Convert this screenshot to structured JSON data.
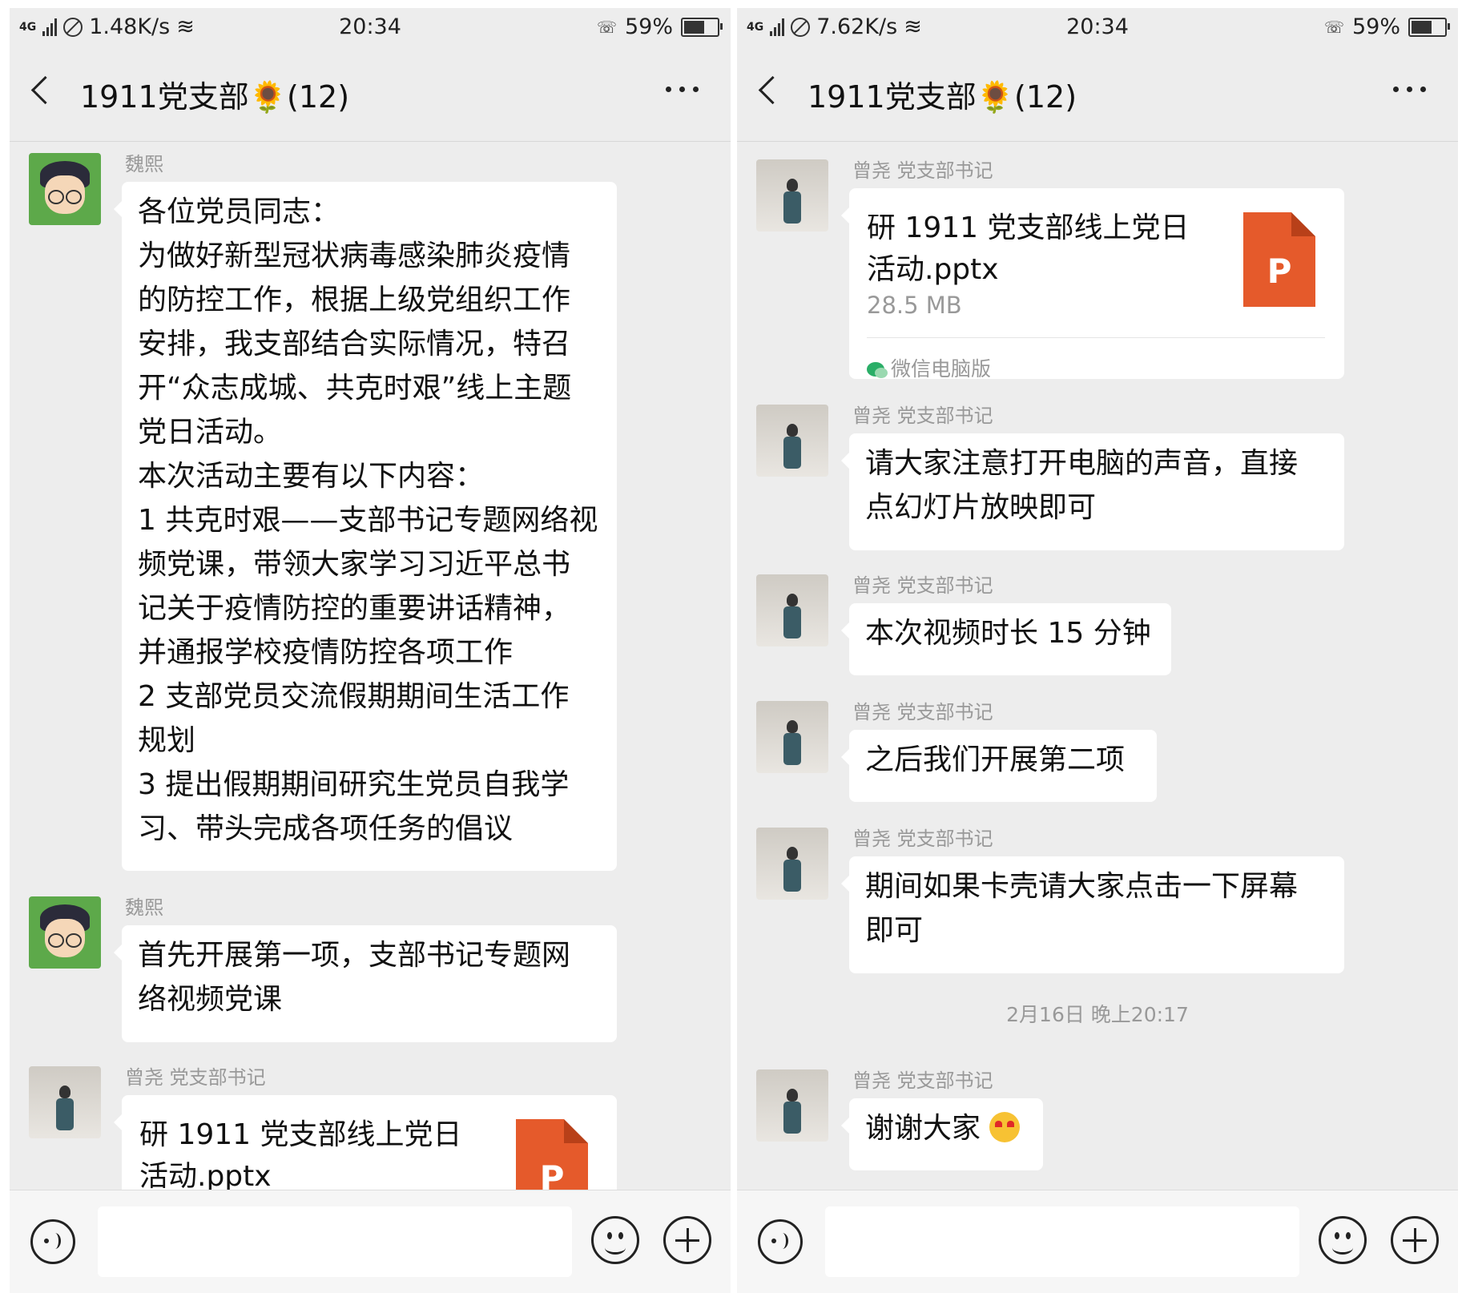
{
  "phones": {
    "left": {
      "status": {
        "speed": "1.48K/s",
        "time": "20:34",
        "battery": "59%",
        "network": "4G"
      },
      "title": "1911党支部🌻(12)",
      "messages": [
        {
          "sender": "魏熙",
          "lines": [
            "各位党员同志：",
            "为做好新型冠状病毒感染肺炎疫情",
            "的防控工作，根据上级党组织工作",
            "安排，我支部结合实际情况，特召",
            "开“众志成城、共克时艰”线上主题",
            "党日活动。",
            "本次活动主要有以下内容：",
            "1 共克时艰——支部书记专题网络视",
            "频党课，带领大家学习习近平总书",
            "记关于疫情防控的重要讲话精神，",
            "并通报学校疫情防控各项工作",
            "2 支部党员交流假期期间生活工作",
            "规划",
            "3 提出假期期间研究生党员自我学",
            "习、带头完成各项任务的倡议"
          ]
        },
        {
          "sender": "魏熙",
          "lines": [
            "首先开展第一项，支部书记专题网",
            "络视频党课"
          ]
        },
        {
          "sender": "曾尧 党支部书记",
          "file_name_lines": [
            "研 1911 党支部线上党日",
            "活动.pptx"
          ],
          "file_icon": "P"
        }
      ]
    },
    "right": {
      "status": {
        "speed": "7.62K/s",
        "time": "20:34",
        "battery": "59%",
        "network": "4G"
      },
      "title": "1911党支部🌻(12)",
      "messages": [
        {
          "sender": "曾尧 党支部书记",
          "file_name_lines": [
            "研 1911 党支部线上党日",
            "活动.pptx"
          ],
          "file_size": "28.5 MB",
          "file_icon": "P",
          "source": "微信电脑版"
        },
        {
          "sender": "曾尧 党支部书记",
          "lines": [
            "请大家注意打开电脑的声音，直接",
            "点幻灯片放映即可"
          ]
        },
        {
          "sender": "曾尧 党支部书记",
          "lines": [
            "本次视频时长 15 分钟"
          ]
        },
        {
          "sender": "曾尧 党支部书记",
          "lines": [
            "之后我们开展第二项"
          ]
        },
        {
          "sender": "曾尧 党支部书记",
          "lines": [
            "期间如果卡壳请大家点击一下屏幕",
            "即可"
          ]
        },
        {
          "sender": "曾尧 党支部书记",
          "text": "谢谢大家"
        }
      ],
      "timestamp": "2月16日 晚上20:17"
    }
  },
  "colors": {
    "chat_bg": "#ededed",
    "bubble_bg": "#ffffff",
    "ppt_orange": "#e55a2b",
    "meta_text": "#999999"
  },
  "icons": [
    "back-arrow-icon",
    "more-dots-icon",
    "voice-icon",
    "emoji-icon",
    "plus-icon",
    "powerpoint-file-icon",
    "wechat-icon",
    "signal-icon",
    "wifi-icon",
    "battery-icon"
  ]
}
